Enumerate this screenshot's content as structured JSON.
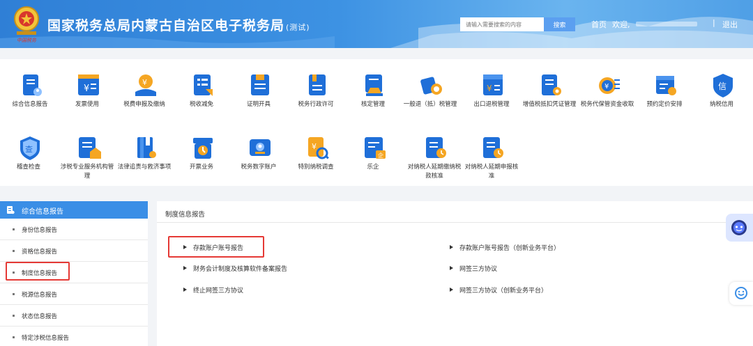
{
  "header": {
    "title": "国家税务总局内蒙古自治区电子税务局",
    "title_suffix": "(测试)",
    "emblem_caption": "中国税务",
    "search_placeholder": "请输入需要搜索的内容",
    "search_button": "搜索",
    "home_link": "首页",
    "welcome_text": "欢迎,",
    "separator": "|",
    "logout_link": "退出"
  },
  "functions": [
    {
      "label": "综合信息报告",
      "icon": "doc-user-icon"
    },
    {
      "label": "发票使用",
      "icon": "invoice-yen-icon"
    },
    {
      "label": "税费申报及缴纳",
      "icon": "tax-payment-icon"
    },
    {
      "label": "税收减免",
      "icon": "tax-reduction-icon"
    },
    {
      "label": "证明开具",
      "icon": "certificate-icon"
    },
    {
      "label": "税务行政许可",
      "icon": "permit-icon"
    },
    {
      "label": "核定管理",
      "icon": "stamp-icon"
    },
    {
      "label": "一般退（抵）税管理",
      "icon": "refund-coin-icon"
    },
    {
      "label": "出口退税管理",
      "icon": "export-refund-icon"
    },
    {
      "label": "增值税抵扣凭证管理",
      "icon": "vat-voucher-icon"
    },
    {
      "label": "税务代保管资金收取",
      "icon": "fund-custody-icon"
    },
    {
      "label": "预约定价安排",
      "icon": "pricing-icon"
    },
    {
      "label": "纳税信用",
      "icon": "credit-shield-icon"
    },
    {
      "label": "稽查检查",
      "icon": "inspection-shield-icon"
    },
    {
      "label": "涉税专业服务机构管理",
      "icon": "agency-icon"
    },
    {
      "label": "法律追责与救济事项",
      "icon": "law-book-icon"
    },
    {
      "label": "开票业务",
      "icon": "printer-icon"
    },
    {
      "label": "税务数字账户",
      "icon": "digital-account-icon"
    },
    {
      "label": "特别纳税调查",
      "icon": "investigation-icon"
    },
    {
      "label": "乐企",
      "icon": "enterprise-icon"
    },
    {
      "label": "对纳税人延期缴纳税款核准",
      "icon": "defer-payment-icon"
    },
    {
      "label": "对纳税人延期申报核准",
      "icon": "defer-declare-icon"
    }
  ],
  "sidebar": {
    "header": "综合信息报告",
    "items": [
      {
        "label": "身份信息报告"
      },
      {
        "label": "资格信息报告"
      },
      {
        "label": "制度信息报告"
      },
      {
        "label": "税源信息报告"
      },
      {
        "label": "状态信息报告"
      },
      {
        "label": "特定涉税信息报告"
      }
    ]
  },
  "content": {
    "title": "制度信息报告",
    "links": [
      {
        "label": "存款账户账号报告"
      },
      {
        "label": "存款账户账号报告（创新业务平台）"
      },
      {
        "label": "财务会计制度及核算软件备案报告"
      },
      {
        "label": "网签三方协议"
      },
      {
        "label": "终止网签三方协议"
      },
      {
        "label": "网签三方协议（创新业务平台）"
      }
    ]
  },
  "colors": {
    "header_blue": "#2f7fd6",
    "sidebar_active": "#3a8ee6",
    "icon_blue": "#1f6fd8",
    "icon_orange": "#f5a623",
    "highlight_red": "#e53935"
  }
}
